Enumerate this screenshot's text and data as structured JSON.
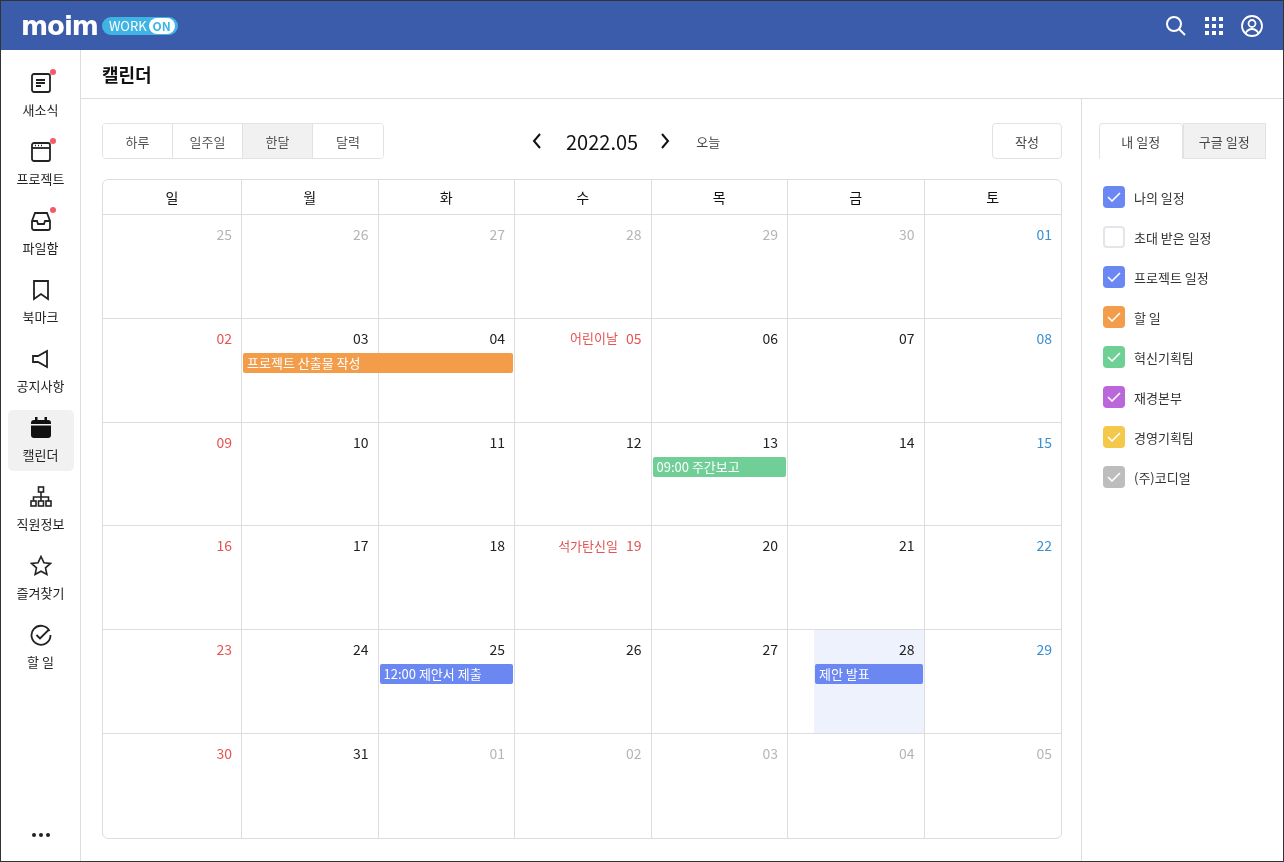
{
  "header": {
    "logo": "moim",
    "badge": "WORK",
    "badge_pill": "ON"
  },
  "sidebar": {
    "items": [
      {
        "label": "새소식",
        "new": true,
        "selected": false
      },
      {
        "label": "프로젝트",
        "new": true,
        "selected": false
      },
      {
        "label": "파일함",
        "new": true,
        "selected": false
      },
      {
        "label": "북마크",
        "new": false,
        "selected": false
      },
      {
        "label": "공지사항",
        "new": false,
        "selected": false
      },
      {
        "label": "캘린더",
        "new": false,
        "selected": true
      },
      {
        "label": "직원정보",
        "new": false,
        "selected": false
      },
      {
        "label": "즐겨찾기",
        "new": false,
        "selected": false
      },
      {
        "label": "할 일",
        "new": false,
        "selected": false
      }
    ]
  },
  "page_title": "캘린더",
  "view_tabs": [
    {
      "label": "하루",
      "selected": false
    },
    {
      "label": "일주일",
      "selected": false
    },
    {
      "label": "한달",
      "selected": true
    },
    {
      "label": "달력",
      "selected": false
    }
  ],
  "month": "2022.05",
  "today_button": "오늘",
  "create_button": "작성",
  "weekdays": [
    "일",
    "월",
    "화",
    "수",
    "목",
    "금",
    "토"
  ],
  "weeks": [
    {
      "days": [
        {
          "date": "25",
          "kind": "other",
          "today": false
        },
        {
          "date": "26",
          "kind": "other",
          "today": false
        },
        {
          "date": "27",
          "kind": "other",
          "today": false
        },
        {
          "date": "28",
          "kind": "other",
          "today": false
        },
        {
          "date": "29",
          "kind": "other",
          "today": false
        },
        {
          "date": "30",
          "kind": "other",
          "today": false
        },
        {
          "date": "01",
          "kind": "sat",
          "today": false
        }
      ]
    },
    {
      "days": [
        {
          "date": "02",
          "kind": "sun",
          "today": false
        },
        {
          "date": "03",
          "kind": "normal",
          "today": false,
          "events": [
            {
              "title": "프로젝트 산출물 작성",
              "kind": "two-day",
              "color": "#f39c4a"
            }
          ]
        },
        {
          "date": "04",
          "kind": "normal",
          "today": false
        },
        {
          "date": "05",
          "kind": "holiday",
          "holiday": "어린이날",
          "today": false
        },
        {
          "date": "06",
          "kind": "normal",
          "today": false
        },
        {
          "date": "07",
          "kind": "normal",
          "today": false
        },
        {
          "date": "08",
          "kind": "sat",
          "today": false
        }
      ]
    },
    {
      "days": [
        {
          "date": "09",
          "kind": "sun",
          "today": false
        },
        {
          "date": "10",
          "kind": "normal",
          "today": false
        },
        {
          "date": "11",
          "kind": "normal",
          "today": false
        },
        {
          "date": "12",
          "kind": "normal",
          "today": false
        },
        {
          "date": "13",
          "kind": "normal",
          "today": false,
          "events": [
            {
              "title": "09:00 주간보고",
              "kind": "one-day",
              "color": "#6fcf97"
            }
          ]
        },
        {
          "date": "14",
          "kind": "normal",
          "today": false
        },
        {
          "date": "15",
          "kind": "sat",
          "today": false
        }
      ]
    },
    {
      "days": [
        {
          "date": "16",
          "kind": "sun",
          "today": false
        },
        {
          "date": "17",
          "kind": "normal",
          "today": false
        },
        {
          "date": "18",
          "kind": "normal",
          "today": false
        },
        {
          "date": "19",
          "kind": "holiday",
          "holiday": "석가탄신일",
          "today": false
        },
        {
          "date": "20",
          "kind": "normal",
          "today": false
        },
        {
          "date": "21",
          "kind": "normal",
          "today": false
        },
        {
          "date": "22",
          "kind": "sat",
          "today": false
        }
      ]
    },
    {
      "days": [
        {
          "date": "23",
          "kind": "sun",
          "today": false
        },
        {
          "date": "24",
          "kind": "normal",
          "today": false
        },
        {
          "date": "25",
          "kind": "normal",
          "today": false,
          "events": [
            {
              "title": "12:00 제안서 제출",
              "kind": "one-day",
              "color": "#6a87f2"
            }
          ]
        },
        {
          "date": "26",
          "kind": "normal",
          "today": false
        },
        {
          "date": "27",
          "kind": "normal",
          "today": false
        },
        {
          "date": "28",
          "kind": "normal",
          "today": true,
          "events": [
            {
              "title": "제안 발표",
              "kind": "one-day",
              "color": "#6a87f2"
            }
          ]
        },
        {
          "date": "29",
          "kind": "sat",
          "today": false
        }
      ]
    },
    {
      "days": [
        {
          "date": "30",
          "kind": "sun",
          "today": false
        },
        {
          "date": "31",
          "kind": "normal",
          "today": false
        },
        {
          "date": "01",
          "kind": "other",
          "today": false
        },
        {
          "date": "02",
          "kind": "other",
          "today": false
        },
        {
          "date": "03",
          "kind": "other",
          "today": false
        },
        {
          "date": "04",
          "kind": "other",
          "today": false
        },
        {
          "date": "05",
          "kind": "other",
          "today": false
        }
      ]
    }
  ],
  "panel_tabs": [
    {
      "label": "내 일정",
      "selected": true
    },
    {
      "label": "구글 일정",
      "selected": false
    }
  ],
  "calendars": [
    {
      "label": "나의 일정",
      "checked": true,
      "color": "#6a87f4"
    },
    {
      "label": "초대 받은 일정",
      "checked": false,
      "color": "#ffffff"
    },
    {
      "label": "프로젝트 일정",
      "checked": true,
      "color": "#6a87f4"
    },
    {
      "label": "할 일",
      "checked": true,
      "color": "#f39c4a"
    },
    {
      "label": "혁신기획팀",
      "checked": true,
      "color": "#6fd095"
    },
    {
      "label": "재경본부",
      "checked": true,
      "color": "#b967d9"
    },
    {
      "label": "경영기획팀",
      "checked": true,
      "color": "#f4c84a"
    },
    {
      "label": "(주)코디얼",
      "checked": true,
      "color": "#bdbdbd"
    }
  ]
}
